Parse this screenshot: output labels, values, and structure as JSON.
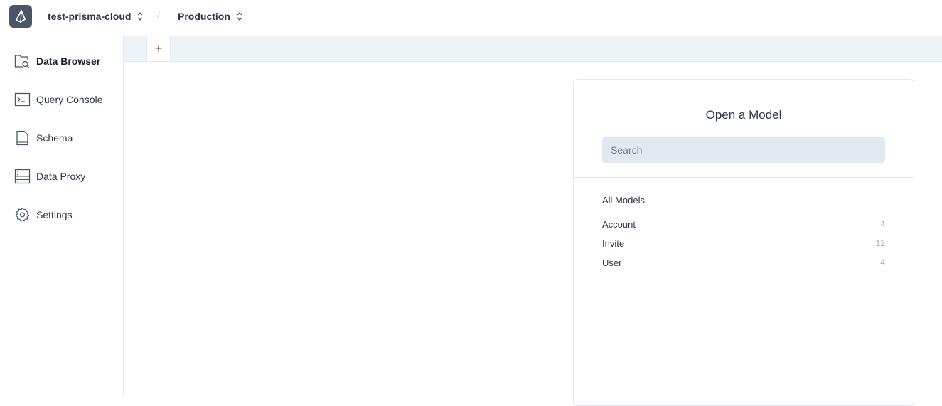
{
  "header": {
    "project": "test-prisma-cloud",
    "separator": "/",
    "environment": "Production"
  },
  "sidebar": {
    "items": [
      {
        "label": "Data Browser",
        "icon": "data-browser-icon",
        "active": true
      },
      {
        "label": "Query Console",
        "icon": "terminal-icon",
        "active": false
      },
      {
        "label": "Schema",
        "icon": "file-icon",
        "active": false
      },
      {
        "label": "Data Proxy",
        "icon": "server-icon",
        "active": false
      },
      {
        "label": "Settings",
        "icon": "gear-icon",
        "active": false
      }
    ]
  },
  "tabs": {
    "add_label": "+"
  },
  "model_panel": {
    "title": "Open a Model",
    "search_placeholder": "Search",
    "section_label": "All Models",
    "models": [
      {
        "name": "Account",
        "count": "4"
      },
      {
        "name": "Invite",
        "count": "12"
      },
      {
        "name": "User",
        "count": "4"
      }
    ]
  },
  "colors": {
    "logo_bg": "#4a5568",
    "tabstrip_bg": "#edf2f7",
    "search_bg": "#e2e8f0",
    "border": "#e2e8f0"
  }
}
